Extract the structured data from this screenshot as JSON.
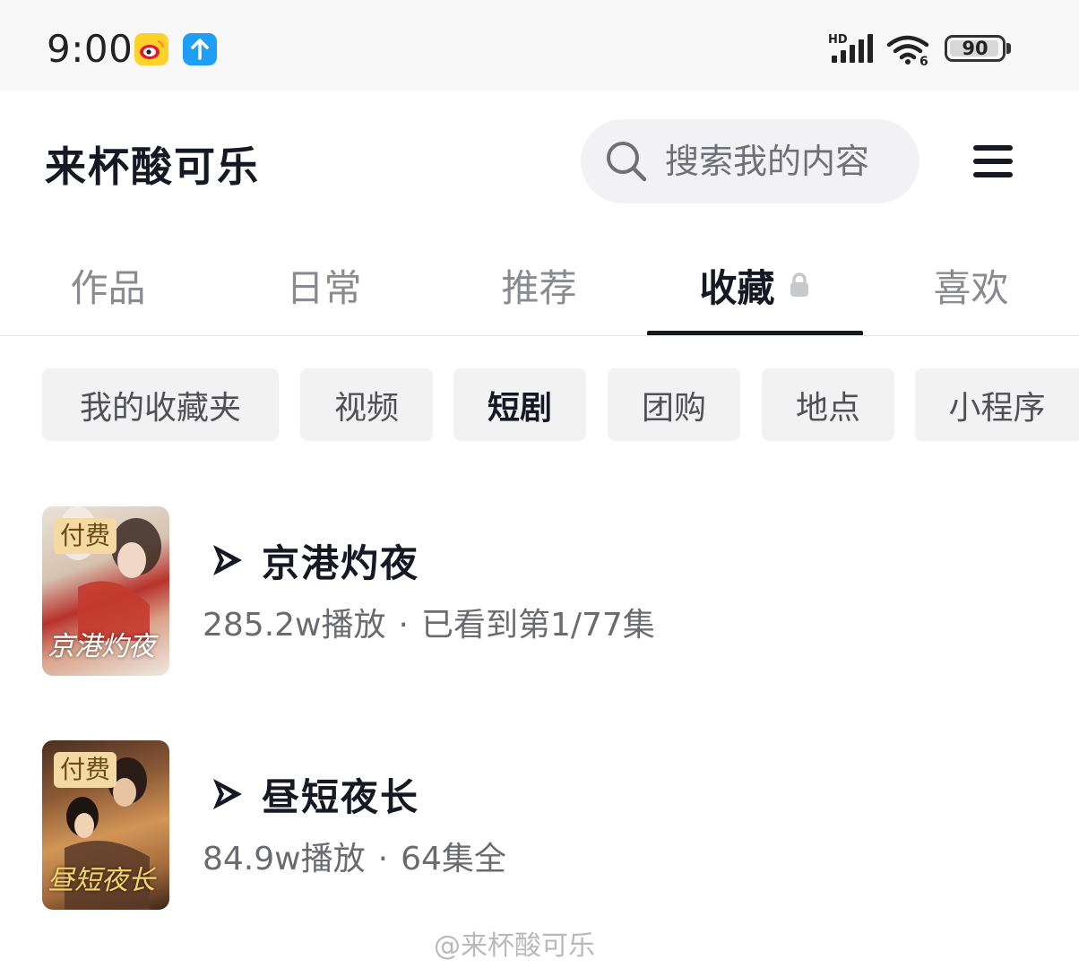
{
  "status_bar": {
    "time": "9:00",
    "signal_tag": "HD",
    "wifi_tag": "6",
    "battery": "90",
    "icons": [
      "weibo-icon",
      "upload-arrow-icon",
      "signal-icon",
      "wifi-icon",
      "battery-icon"
    ]
  },
  "header": {
    "title": "来杯酸可乐",
    "search_placeholder": "搜索我的内容",
    "search_icon": "search-icon",
    "menu_icon": "menu-icon"
  },
  "tabs": [
    {
      "label": "作品"
    },
    {
      "label": "日常"
    },
    {
      "label": "推荐"
    },
    {
      "label": "收藏",
      "active": true,
      "icon": "lock-icon"
    },
    {
      "label": "喜欢"
    }
  ],
  "filters": [
    {
      "label": "我的收藏夹"
    },
    {
      "label": "视频"
    },
    {
      "label": "短剧",
      "active": true
    },
    {
      "label": "团购"
    },
    {
      "label": "地点"
    },
    {
      "label": "小程序"
    }
  ],
  "items": [
    {
      "badge": "付费",
      "title": "京港灼夜",
      "plays": "285.2w播放",
      "separator": "·",
      "progress": "已看到第1/77集",
      "cover_text": "京港灼夜",
      "icon": "short-drama-play-icon"
    },
    {
      "badge": "付费",
      "title": "昼短夜长",
      "plays": "84.9w播放",
      "separator": "·",
      "progress": "64集全",
      "cover_text": "昼短夜长",
      "icon": "short-drama-play-icon"
    }
  ],
  "watermark": "@来杯酸可乐",
  "colors": {
    "text_primary": "#161823",
    "text_secondary": "#8a8b91",
    "chip_bg": "#f2f2f2",
    "badge_bg": "#f4d9a3"
  }
}
